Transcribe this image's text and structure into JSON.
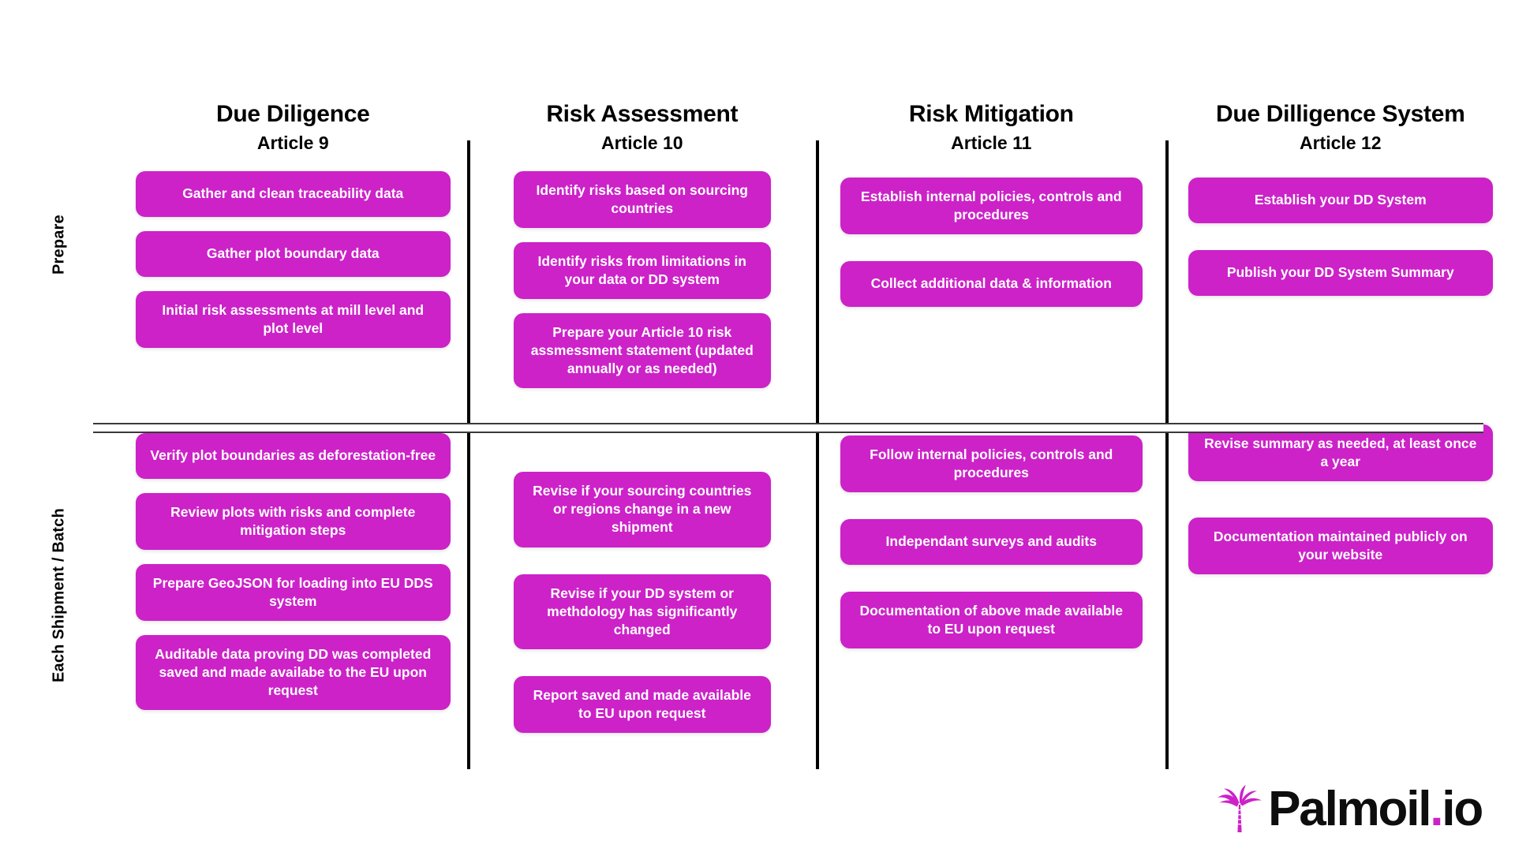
{
  "rows": [
    {
      "label": "Prepare"
    },
    {
      "label": "Each Shipment / Batch"
    }
  ],
  "colors": {
    "card_fill": "#CC22C8",
    "card_text": "#FFFFFF",
    "divider": "#000000",
    "logo_accent": "#CC22C8",
    "logo_text": "#0D0D0D",
    "background": "#FFFFFF"
  },
  "columns": [
    {
      "title": "Due Diligence",
      "article": "Article 9",
      "prepare": [
        "Gather and clean traceability data",
        "Gather plot boundary data",
        "Initial risk assessments at mill level and plot level"
      ],
      "shipment": [
        "Verify plot boundaries as deforestation-free",
        "Review plots with risks and complete mitigation steps",
        "Prepare GeoJSON for loading into EU DDS system",
        "Auditable data proving DD was completed saved and made availabe to the EU upon request"
      ]
    },
    {
      "title": "Risk Assessment",
      "article": "Article 10",
      "prepare": [
        "Identify risks based on sourcing countries",
        "Identify risks from limitations in your data or DD system",
        "Prepare your Article 10 risk assmessment statement (updated annually or as needed)"
      ],
      "shipment": [
        "Revise if your sourcing countries or regions change in a new shipment",
        "Revise if your DD system or methdology has significantly changed",
        "Report saved and made available to EU upon request"
      ]
    },
    {
      "title": "Risk Mitigation",
      "article": "Article 11",
      "prepare": [
        "Establish internal policies, controls and procedures",
        "Collect additional data & information"
      ],
      "shipment": [
        "Follow internal policies, controls and procedures",
        "Independant surveys and audits",
        "Documentation of above made available to EU upon request"
      ]
    },
    {
      "title": "Due Dilligence System",
      "article": "Article 12",
      "prepare": [
        "Establish your DD System",
        "Publish your DD System Summary"
      ],
      "shipment": [
        "Revise summary as needed, at least once a year",
        "Documentation maintained publicly on your website"
      ]
    }
  ],
  "logo": {
    "icon": "palm-tree-icon",
    "name": "Palmoil",
    "dot": ".",
    "tld": "io"
  }
}
